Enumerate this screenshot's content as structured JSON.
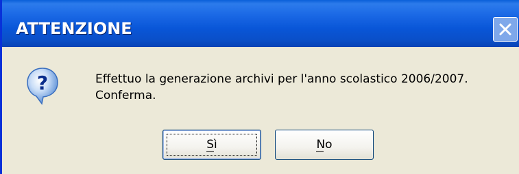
{
  "window": {
    "title": "ATTENZIONE"
  },
  "icons": {
    "dialog_icon": "question-icon",
    "close": "close-icon"
  },
  "message": {
    "line1": "Effettuo la generazione archivi per l'anno scolastico 2006/2007.",
    "line2": "Conferma."
  },
  "buttons": {
    "yes_label": "Sì",
    "no_label": "No"
  },
  "colors": {
    "titlebar_blue": "#0A53D0",
    "dialog_background": "#ECE9D8",
    "button_border": "#003C74"
  }
}
